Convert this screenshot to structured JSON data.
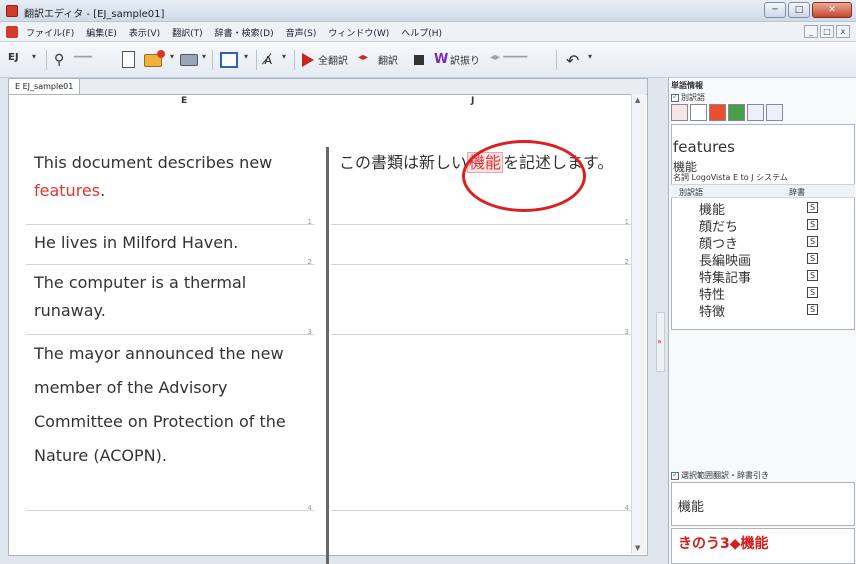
{
  "window": {
    "title": "翻訳エディタ - [EJ_sample01]",
    "minimize": "─",
    "maximize": "□",
    "close": "✕"
  },
  "menu": {
    "items": [
      "ファイル(F)",
      "編集(E)",
      "表示(V)",
      "翻訳(T)",
      "辞書・検索(D)",
      "音声(S)",
      "ウィンドウ(W)",
      "ヘルプ(H)"
    ],
    "mdi": [
      "_",
      "□",
      "x"
    ]
  },
  "toolbar": {
    "direction": "EJ",
    "translate_all": "全翻訳",
    "translate": "翻訳",
    "alt_translations": "訳振り",
    "dropdown": "▾"
  },
  "document": {
    "tab": "EJ_sample01",
    "col_e": "E",
    "col_j": "J",
    "segments": [
      {
        "num": "1",
        "en_pre": "This document describes new ",
        "en_hl": "features",
        "en_post": ".",
        "ja_pre": "この書類は新しい",
        "ja_hl": "機能",
        "ja_post": "を記述します。"
      },
      {
        "num": "2",
        "en": "He lives in Milford Haven.",
        "ja": ""
      },
      {
        "num": "3",
        "en": "The computer is a thermal runaway.",
        "ja": ""
      },
      {
        "num": "4",
        "en": "The mayor announced the new member of the Advisory Committee on Protection of the Nature (ACOPN).",
        "ja": ""
      }
    ]
  },
  "side_panel": {
    "title": "単語情報",
    "alt_label": "別訳語",
    "word": "features",
    "translation": "機能",
    "meta": "名詞 LogoVista E to J システム",
    "list_hdr_alt": "別訳語",
    "list_hdr_dict": "辞書",
    "alternatives": [
      "機能",
      "顔だち",
      "顔つき",
      "長編映画",
      "特集記事",
      "特性",
      "特徴"
    ],
    "dict_mark": "S",
    "selection_label": "選択範囲翻訳・辞書引き",
    "selection_text": "機能",
    "dict_entry": "きのう3◆機能"
  }
}
